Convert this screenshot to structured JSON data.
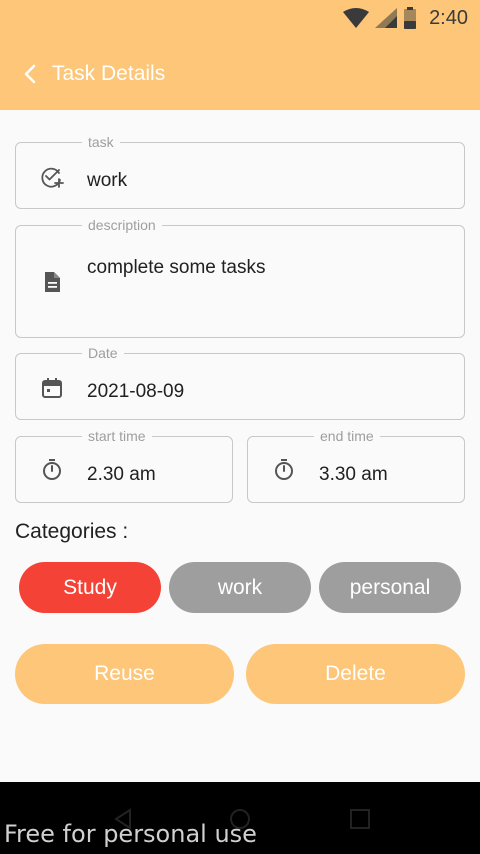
{
  "status_bar": {
    "time": "2:40"
  },
  "header": {
    "title": "Task Details"
  },
  "task": {
    "label": "task",
    "value": "work"
  },
  "description": {
    "label": "description",
    "value": "complete some tasks"
  },
  "date": {
    "label": "Date",
    "value": "2021-08-09"
  },
  "start_time": {
    "label": "start time",
    "value": "2.30 am"
  },
  "end_time": {
    "label": "end time",
    "value": "3.30 am"
  },
  "categories": {
    "title": "Categories :",
    "items": [
      {
        "label": "Study",
        "selected": true,
        "color": "#f44336"
      },
      {
        "label": "work",
        "selected": false,
        "color": "#9e9e9e"
      },
      {
        "label": "personal",
        "selected": false,
        "color": "#9e9e9e"
      }
    ]
  },
  "actions": {
    "reuse_label": "Reuse",
    "delete_label": "Delete"
  },
  "colors": {
    "accent": "#fdc679",
    "selected_chip": "#f44336",
    "unselected_chip": "#9e9e9e"
  },
  "watermark": "Free for personal use"
}
